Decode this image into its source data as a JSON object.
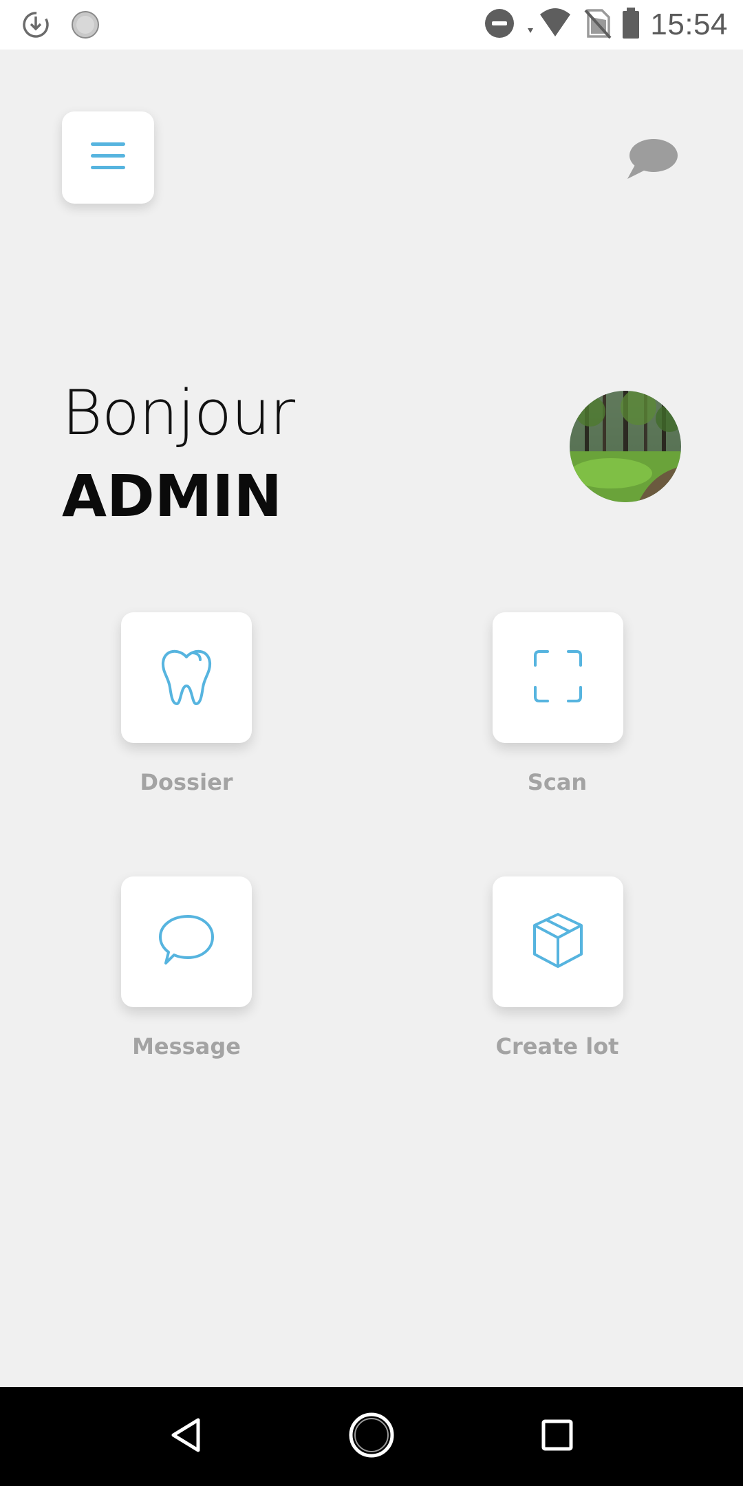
{
  "status_bar": {
    "time": "15:54",
    "left_icons": [
      "sync-download-icon",
      "loading-icon"
    ],
    "right_icons": [
      "do-not-disturb-icon",
      "wifi-icon",
      "no-sim-icon",
      "battery-icon"
    ]
  },
  "header": {
    "menu_icon": "hamburger-menu-icon",
    "chat_icon": "chat-bubble-icon"
  },
  "greeting": {
    "hello": "Bonjour",
    "name": "ADMIN"
  },
  "tiles": [
    {
      "label": "Dossier",
      "icon": "tooth-icon"
    },
    {
      "label": "Scan",
      "icon": "scan-frame-icon"
    },
    {
      "label": "Message",
      "icon": "message-bubble-icon"
    },
    {
      "label": "Create lot",
      "icon": "box-icon"
    }
  ],
  "colors": {
    "accent": "#56b4df",
    "background": "#f0f0f0",
    "card": "#ffffff",
    "label": "#a3a3a3"
  },
  "nav_bar": [
    "back-icon",
    "home-icon",
    "recents-icon"
  ]
}
